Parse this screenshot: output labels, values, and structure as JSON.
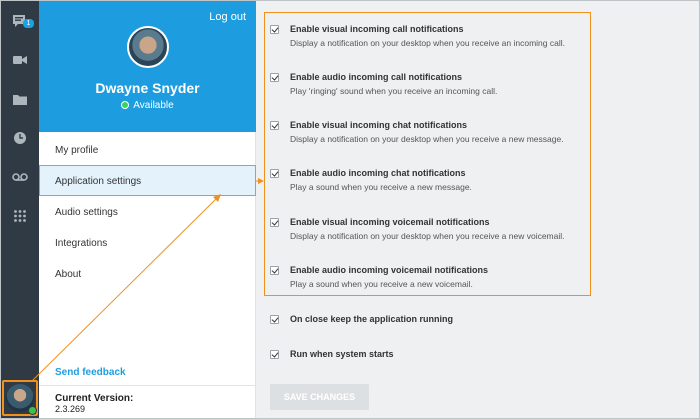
{
  "rail": {
    "badge_count": "1",
    "icons": [
      "chat-icon",
      "video-icon",
      "folder-icon",
      "clock-icon",
      "voicemail-icon",
      "dialpad-icon"
    ]
  },
  "profile": {
    "logout_label": "Log out",
    "name": "Dwayne Snyder",
    "status": "Available"
  },
  "menu": {
    "items": [
      {
        "label": "My profile"
      },
      {
        "label": "Application settings"
      },
      {
        "label": "Audio settings"
      },
      {
        "label": "Integrations"
      },
      {
        "label": "About"
      }
    ]
  },
  "footer": {
    "feedback_label": "Send feedback",
    "version_label": "Current Version:",
    "version_value": "2.3.269"
  },
  "settings": {
    "notifications": [
      {
        "title": "Enable visual incoming call notifications",
        "desc": "Display a notification on your desktop when you receive an incoming call.",
        "checked": true
      },
      {
        "title": "Enable audio incoming call notifications",
        "desc": "Play 'ringing' sound when you receive an incoming call.",
        "checked": true
      },
      {
        "title": "Enable visual incoming chat notifications",
        "desc": "Display a notification on your desktop when you receive a new message.",
        "checked": true
      },
      {
        "title": "Enable audio incoming chat notifications",
        "desc": "Play a sound when you receive a new message.",
        "checked": true
      },
      {
        "title": "Enable visual incoming voicemail notifications",
        "desc": "Display a notification on your desktop when you receive a new voicemail.",
        "checked": true
      },
      {
        "title": "Enable audio incoming voicemail notifications",
        "desc": "Play a sound when you receive a new voicemail.",
        "checked": true
      }
    ],
    "other": [
      {
        "title": "On close keep the application running",
        "checked": true
      },
      {
        "title": "Run when system starts",
        "checked": true
      }
    ],
    "save_label": "SAVE CHANGES"
  },
  "colors": {
    "brand_blue": "#1d9de0",
    "rail_dark": "#2f3a45",
    "highlight_orange": "#f0911e",
    "online_green": "#3bbf4a"
  }
}
